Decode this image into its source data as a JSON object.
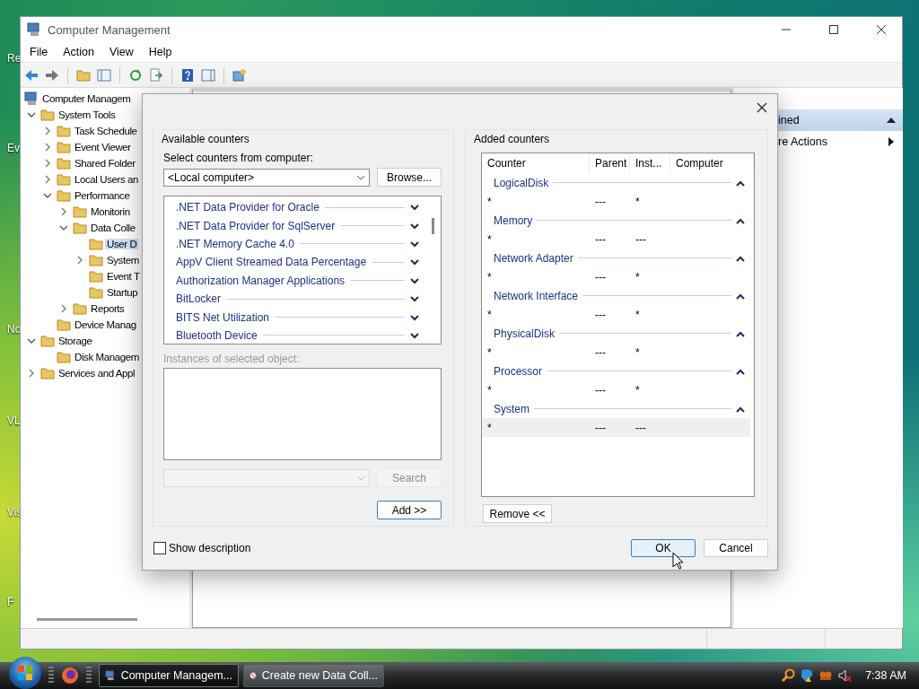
{
  "desktop": {
    "icons": [
      {
        "label": "Re"
      },
      {
        "label": "Ev"
      },
      {
        "label": "No"
      },
      {
        "label": "VL"
      },
      {
        "label": "Vis"
      },
      {
        "label": "F"
      }
    ]
  },
  "window": {
    "title": "Computer Management",
    "menu": [
      "File",
      "Action",
      "View",
      "Help"
    ],
    "tree": [
      {
        "label": "Computer Managem",
        "expandable": false,
        "selected": false,
        "children": [
          {
            "label": "System Tools",
            "expandable": true,
            "expanded": true,
            "selected": false,
            "children": [
              {
                "label": "Task Schedule",
                "expandable": true,
                "expanded": false,
                "selected": false
              },
              {
                "label": "Event Viewer",
                "expandable": true,
                "expanded": false,
                "selected": false
              },
              {
                "label": "Shared Folder",
                "expandable": true,
                "expanded": false,
                "selected": false
              },
              {
                "label": "Local Users an",
                "expandable": true,
                "expanded": false,
                "selected": false
              },
              {
                "label": "Performance",
                "expandable": true,
                "expanded": true,
                "selected": false,
                "children": [
                  {
                    "label": "Monitorin",
                    "expandable": true,
                    "expanded": false,
                    "selected": false
                  },
                  {
                    "label": "Data Colle",
                    "expandable": true,
                    "expanded": true,
                    "selected": false,
                    "children": [
                      {
                        "label": "User D",
                        "expandable": false,
                        "selected": true
                      },
                      {
                        "label": "System",
                        "expandable": true,
                        "expanded": false,
                        "selected": false
                      },
                      {
                        "label": "Event T",
                        "expandable": false,
                        "selected": false
                      },
                      {
                        "label": "Startup",
                        "expandable": false,
                        "selected": false
                      }
                    ]
                  },
                  {
                    "label": "Reports",
                    "expandable": true,
                    "expanded": false,
                    "selected": false
                  }
                ]
              },
              {
                "label": "Device Manag",
                "expandable": false,
                "selected": false
              }
            ]
          },
          {
            "label": "Storage",
            "expandable": true,
            "expanded": true,
            "selected": false,
            "children": [
              {
                "label": "Disk Managem",
                "expandable": false,
                "selected": false
              }
            ]
          },
          {
            "label": "Services and Appl",
            "expandable": true,
            "expanded": false,
            "selected": false
          }
        ]
      }
    ],
    "actions": [
      {
        "label": "ined",
        "kind": "header"
      },
      {
        "label": "re Actions",
        "kind": "item"
      }
    ]
  },
  "dialog": {
    "available": {
      "title": "Available counters",
      "computer_label": "Select counters from computer:",
      "computer": "<Local computer>",
      "browse": "Browse...",
      "counters": [
        {
          "label": ".NET Data Provider for Oracle",
          "expanded": false
        },
        {
          "label": ".NET Data Provider for SqlServer",
          "expanded": false
        },
        {
          "label": ".NET Memory Cache 4.0",
          "expanded": false
        },
        {
          "label": "AppV Client Streamed Data Percentage",
          "expanded": false
        },
        {
          "label": "Authorization Manager Applications",
          "expanded": false
        },
        {
          "label": "BitLocker",
          "expanded": false
        },
        {
          "label": "BITS Net Utilization",
          "expanded": false
        },
        {
          "label": "Bluetooth Device",
          "expanded": false
        }
      ],
      "instances_label": "Instances of selected object:",
      "instances_disabled": true,
      "search": "Search",
      "add": "Add >>"
    },
    "added": {
      "title": "Added counters",
      "columns": [
        "Counter",
        "Parent",
        "Inst...",
        "Computer"
      ],
      "groups": [
        {
          "name": "LogicalDisk",
          "expanded": true,
          "rows": [
            {
              "counter": "*",
              "parent": "---",
              "instance": "*",
              "selected": false
            }
          ]
        },
        {
          "name": "Memory",
          "expanded": true,
          "rows": [
            {
              "counter": "*",
              "parent": "---",
              "instance": "---",
              "selected": false
            }
          ]
        },
        {
          "name": "Network Adapter",
          "expanded": true,
          "rows": [
            {
              "counter": "*",
              "parent": "---",
              "instance": "*",
              "selected": false
            }
          ]
        },
        {
          "name": "Network Interface",
          "expanded": true,
          "rows": [
            {
              "counter": "*",
              "parent": "---",
              "instance": "*",
              "selected": false
            }
          ]
        },
        {
          "name": "PhysicalDisk",
          "expanded": true,
          "rows": [
            {
              "counter": "*",
              "parent": "---",
              "instance": "*",
              "selected": false
            }
          ]
        },
        {
          "name": "Processor",
          "expanded": true,
          "rows": [
            {
              "counter": "*",
              "parent": "---",
              "instance": "*",
              "selected": false
            }
          ]
        },
        {
          "name": "System",
          "expanded": true,
          "rows": [
            {
              "counter": "*",
              "parent": "---",
              "instance": "---",
              "selected": true
            }
          ]
        }
      ],
      "remove": "Remove <<"
    },
    "show_description": {
      "label": "Show description",
      "checked": false
    },
    "buttons": [
      {
        "label": "OK",
        "kind": "default"
      },
      {
        "label": "Cancel",
        "kind": "normal"
      }
    ]
  },
  "taskbar": {
    "tasks": [
      {
        "label": "Computer Managem...",
        "selected": true
      },
      {
        "label": "Create new Data Coll...",
        "selected": false
      }
    ],
    "clock": "7:38 AM"
  }
}
